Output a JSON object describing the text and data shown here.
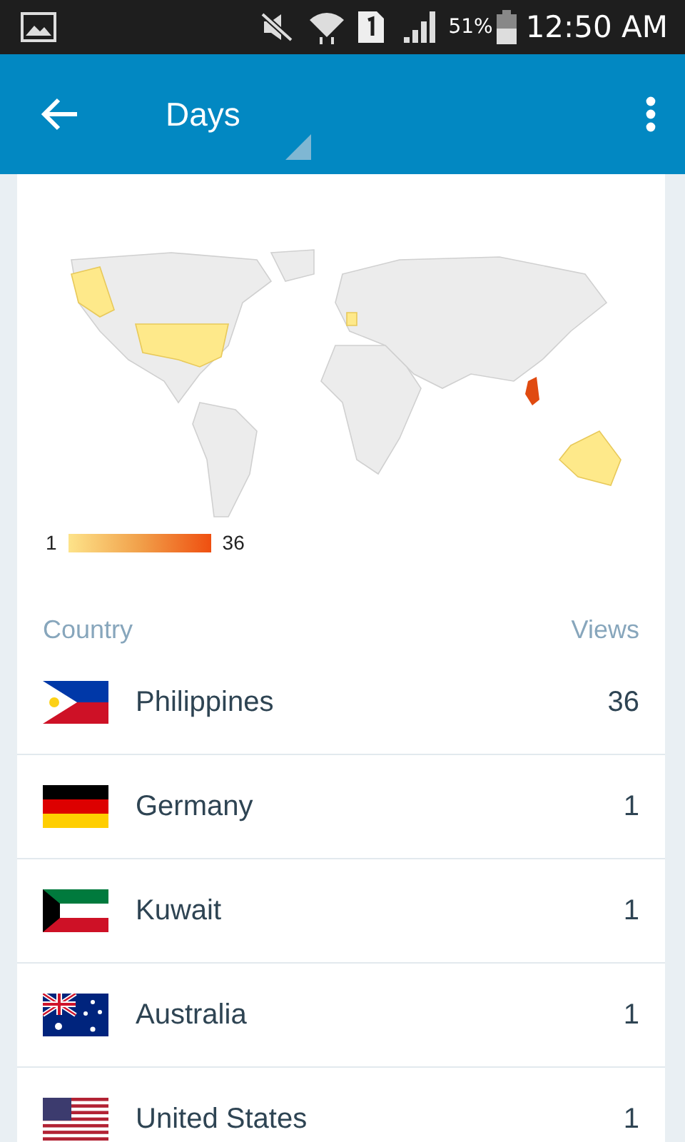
{
  "status_bar": {
    "battery_percent": "51%",
    "time": "12:50 AM"
  },
  "app_bar": {
    "title": "Days"
  },
  "map": {
    "legend_min": "1",
    "legend_max": "36"
  },
  "table": {
    "columns": [
      "Country",
      "Views"
    ],
    "rows": [
      {
        "kind": "ph",
        "country": "Philippines",
        "views": "36"
      },
      {
        "kind": "de",
        "country": "Germany",
        "views": "1"
      },
      {
        "kind": "kw",
        "country": "Kuwait",
        "views": "1"
      },
      {
        "kind": "au",
        "country": "Australia",
        "views": "1"
      },
      {
        "kind": "us",
        "country": "United States",
        "views": "1"
      }
    ]
  }
}
